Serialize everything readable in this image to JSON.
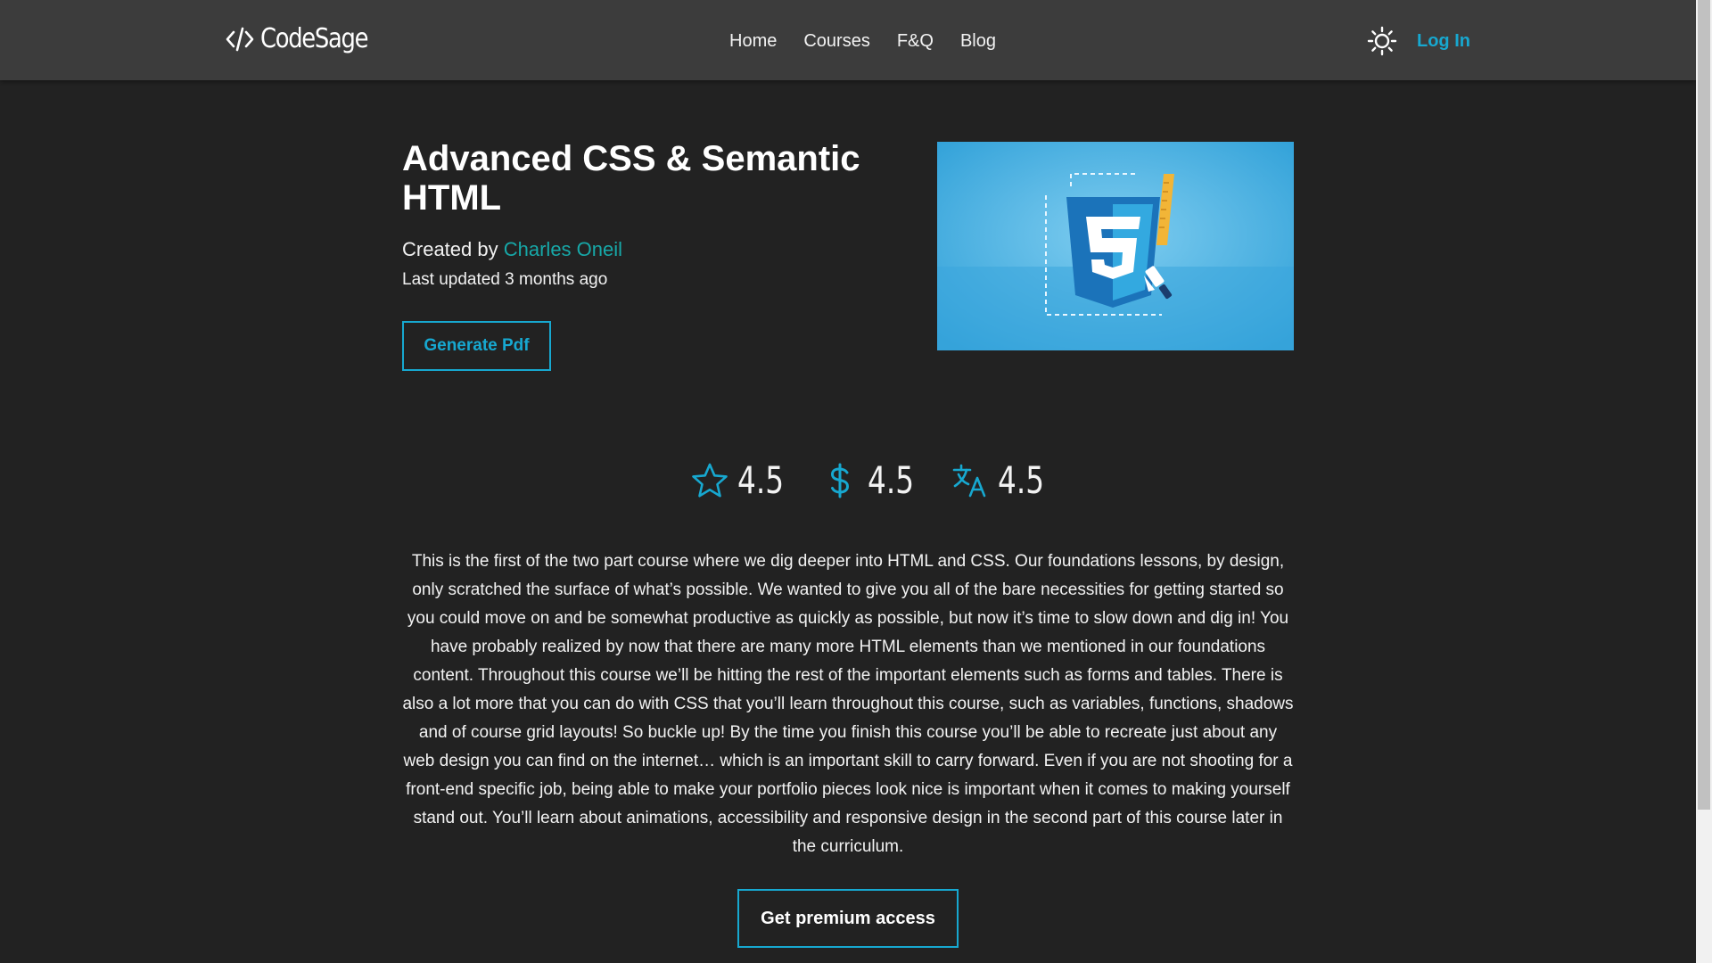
{
  "header": {
    "brand": "CodeSage",
    "brand_icon": "code-brackets-icon",
    "nav": [
      {
        "label": "Home"
      },
      {
        "label": "Courses"
      },
      {
        "label": "F&Q"
      },
      {
        "label": "Blog"
      }
    ],
    "theme_toggle_icon": "sun-icon",
    "login_label": "Log In"
  },
  "course": {
    "title": "Advanced CSS & Semantic HTML",
    "created_by_prefix": "Created by",
    "author": "Charles Oneil",
    "last_updated": "Last updated 3 months ago",
    "pdf_button_label": "Generate Pdf",
    "image_icon": "css3-logo-icon",
    "stats": [
      {
        "icon": "star-icon",
        "value": "4.5"
      },
      {
        "icon": "dollar-icon",
        "value": "4.5"
      },
      {
        "icon": "translate-icon",
        "value": "4.5"
      }
    ],
    "description": "This is the first of the two part course where we dig deeper into HTML and CSS. Our foundations lessons, by design, only scratched the surface of what’s possible. We wanted to give you all of the bare necessities for getting started so you could move on and be somewhat productive as quickly as possible, but now it’s time to slow down and dig in! You have probably realized by now that there are many more HTML elements than we mentioned in our foundations content. Throughout this course we’ll be hitting the rest of the important elements such as forms and tables. There is also a lot more that you can do with CSS that you’ll learn throughout this course, such as variables, functions, shadows and of course grid layouts! So buckle up! By the time you finish this course you’ll be able to recreate just about any web design you can find on the internet… which is an important skill to carry forward. Even if you are not shooting for a front-end specific job, being able to make your portfolio pieces look nice is important when it comes to making yourself stand out. You’ll learn about animations, accessibility and responsive design in the second part of this course later in the curriculum.",
    "premium_button_label": "Get premium access"
  },
  "colors": {
    "page_background": "#222222",
    "header_background": "#3c3c3c",
    "accent": "#17a8d0",
    "author_link": "#17a8a8",
    "text": "#f2f2f2"
  }
}
